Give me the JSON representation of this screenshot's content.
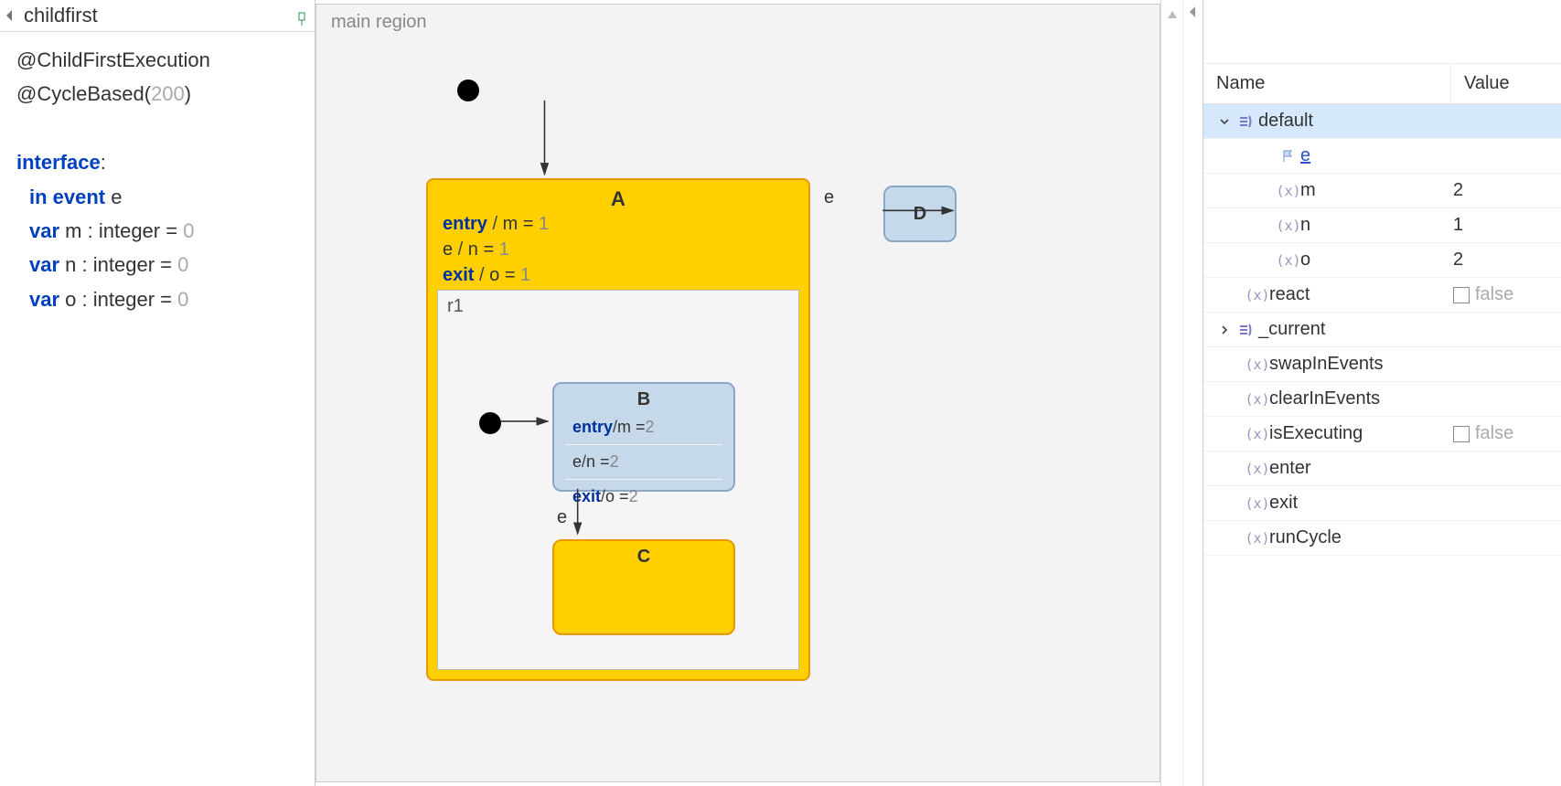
{
  "left": {
    "title": "childfirst",
    "annotations": {
      "childFirst": "@ChildFirstExecution",
      "cycleBasedPrefix": "@CycleBased(",
      "cycleBasedValue": "200",
      "cycleBasedSuffix": ")"
    },
    "interfaceKw": "interface",
    "colon": ":",
    "inEvent": {
      "in": "in event",
      "name": "e"
    },
    "vars": [
      {
        "kw": "var",
        "name": "m",
        "type": ": integer =",
        "val": "0"
      },
      {
        "kw": "var",
        "name": "n",
        "type": ": integer =",
        "val": "0"
      },
      {
        "kw": "var",
        "name": "o",
        "type": ": integer =",
        "val": "0"
      }
    ]
  },
  "canvas": {
    "regionLabel": "main region",
    "stateA": {
      "title": "A",
      "lines": [
        {
          "kw": "entry",
          "sep": " / ",
          "expr": "m = ",
          "num": "1"
        },
        {
          "kw": "e",
          "sep": " / ",
          "expr": "n = ",
          "num": "1"
        },
        {
          "kw": "exit",
          "sep": " / ",
          "expr": "o = ",
          "num": "1"
        }
      ],
      "innerRegion": "r1"
    },
    "stateB": {
      "title": "B",
      "lines": [
        {
          "kw": "entry",
          "sep": " / ",
          "expr": "m = ",
          "num": "2"
        },
        {
          "kw": "e",
          "sep": " / ",
          "expr": "n = ",
          "num": "2"
        },
        {
          "kw": "exit",
          "sep": " / ",
          "expr": "o = ",
          "num": "2"
        }
      ]
    },
    "stateC": {
      "title": "C"
    },
    "stateD": {
      "title": "D"
    },
    "transAE": "e",
    "transBC": "e"
  },
  "variables": {
    "header": {
      "name": "Name",
      "value": "Value"
    },
    "rows": [
      {
        "kind": "scope-open",
        "name": "default"
      },
      {
        "kind": "event",
        "name": "e"
      },
      {
        "kind": "var",
        "name": "m",
        "value": "2"
      },
      {
        "kind": "var",
        "name": "n",
        "value": "1"
      },
      {
        "kind": "var",
        "name": "o",
        "value": "2"
      },
      {
        "kind": "op",
        "name": "react",
        "checkbox": true,
        "boolText": "false"
      },
      {
        "kind": "scope-closed",
        "name": "_current"
      },
      {
        "kind": "op",
        "name": "swapInEvents"
      },
      {
        "kind": "op",
        "name": "clearInEvents"
      },
      {
        "kind": "op",
        "name": "isExecuting",
        "checkbox": true,
        "boolText": "false"
      },
      {
        "kind": "op",
        "name": "enter"
      },
      {
        "kind": "op",
        "name": "exit"
      },
      {
        "kind": "op",
        "name": "runCycle"
      }
    ]
  }
}
